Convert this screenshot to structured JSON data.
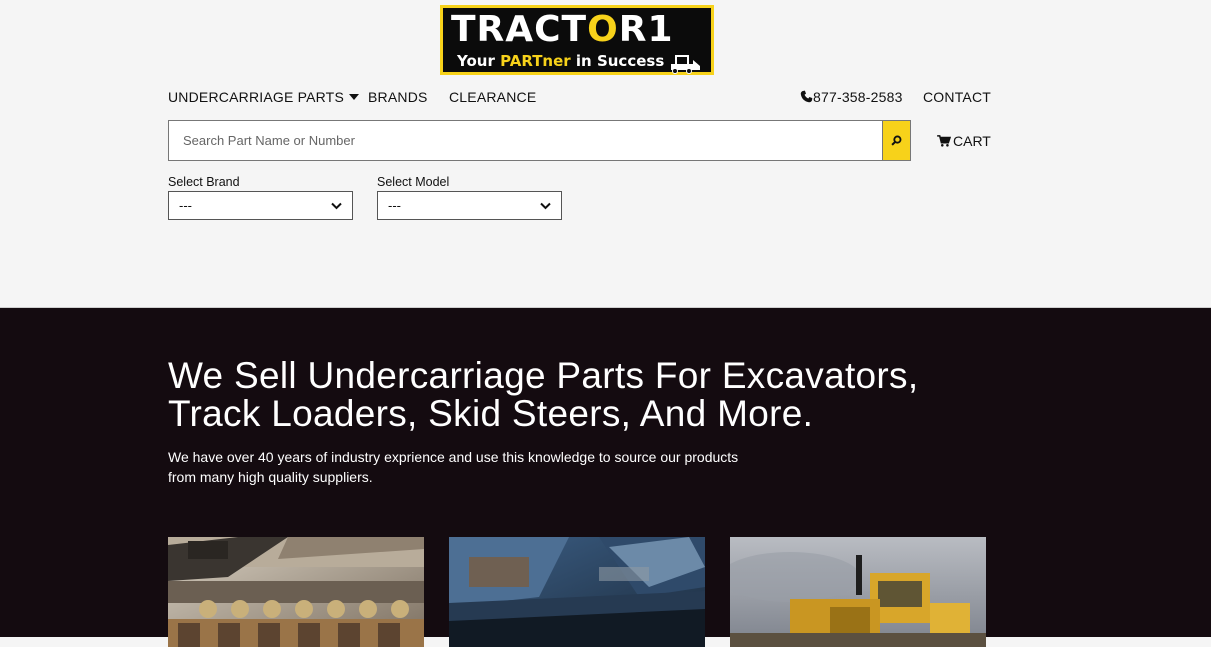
{
  "logo": {
    "title_left": "TRACT",
    "title_gear": "O",
    "title_right": "R1",
    "tagline_pre": "Your ",
    "tagline_highlight": "PARTner",
    "tagline_post": " in Success",
    "brand_yellow": "#f7d21a"
  },
  "nav": {
    "undercarriage": "UNDERCARRIAGE PARTS",
    "brands": "BRANDS",
    "clearance": "CLEARANCE",
    "phone": "877-358-2583",
    "contact": "CONTACT"
  },
  "search": {
    "placeholder": "Search Part Name or Number"
  },
  "cart": {
    "label": "CART"
  },
  "filters": {
    "brand_label": "Select Brand",
    "brand_value": "---",
    "model_label": "Select Model",
    "model_value": "---"
  },
  "hero": {
    "title": "We Sell Undercarriage Parts For Excavators, Track Loaders, Skid Steers, And More.",
    "text": "We have over 40 years of industry exprience and use this knowledge to source our products from many high quality suppliers.",
    "background": "#140b10"
  },
  "cards": [
    {
      "icon": "undercarriage-track-photo"
    },
    {
      "icon": "bucket-closeup-photo"
    },
    {
      "icon": "bulldozer-photo"
    }
  ]
}
